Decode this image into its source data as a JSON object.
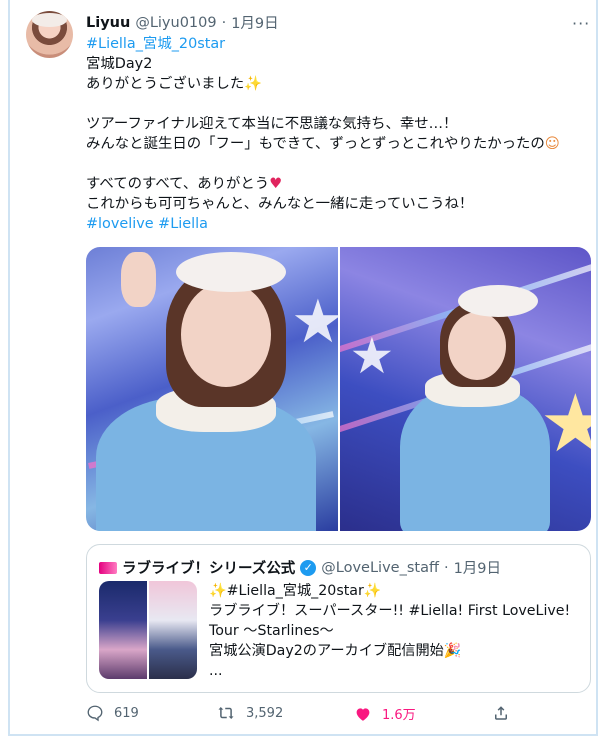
{
  "tweet": {
    "display_name": "Liyuu",
    "handle": "@Liyu0109",
    "separator": "·",
    "date": "1月9日",
    "more_label": "···",
    "lines": [
      {
        "text": "#Liella_宮城_20star",
        "link": true
      },
      {
        "text": "宮城Day2",
        "link": false
      },
      {
        "text": "ありがとうございました",
        "link": false,
        "emoji": "✨"
      },
      {
        "text": "",
        "link": false
      },
      {
        "text": "ツアーファイナル迎えて本当に不思議な気持ち、幸せ…！",
        "link": false
      },
      {
        "text": "みんなと誕生日の「フー」もできて、ずっとずっとこれやりたかったの",
        "link": false,
        "emoji": "☺"
      },
      {
        "text": "",
        "link": false
      },
      {
        "text": "すべてのすべて、ありがとう",
        "link": false,
        "emoji": "♥"
      },
      {
        "text": "これからも可可ちゃんと、みんなと一緒に走っていこうね！",
        "link": false
      },
      {
        "text": "#lovelive #Liella",
        "link": true
      }
    ]
  },
  "quote": {
    "account_name": "ラブライブ！シリーズ公式",
    "verified_mark": "✓",
    "handle": "@LoveLive_staff",
    "separator": "·",
    "date": "1月9日",
    "emoji_left": "✨",
    "hashtag": "#Liella_宮城_20star",
    "emoji_right": "✨",
    "line2": "ラブライブ！スーパースター!! #Liella! First LoveLive!",
    "line3": "Tour 〜Starlines〜",
    "line4": "宮城公演Day2のアーカイブ配信開始",
    "line4_emoji": "🎉",
    "line5": "..."
  },
  "actions": {
    "reply_count": "619",
    "retweet_count": "3,592",
    "like_count": "1.6万",
    "like_color": "#f91880",
    "muted_color": "#536471",
    "link_color": "#1d9bf0",
    "icons": [
      "reply-icon",
      "retweet-icon",
      "heart-icon",
      "share-icon"
    ]
  }
}
